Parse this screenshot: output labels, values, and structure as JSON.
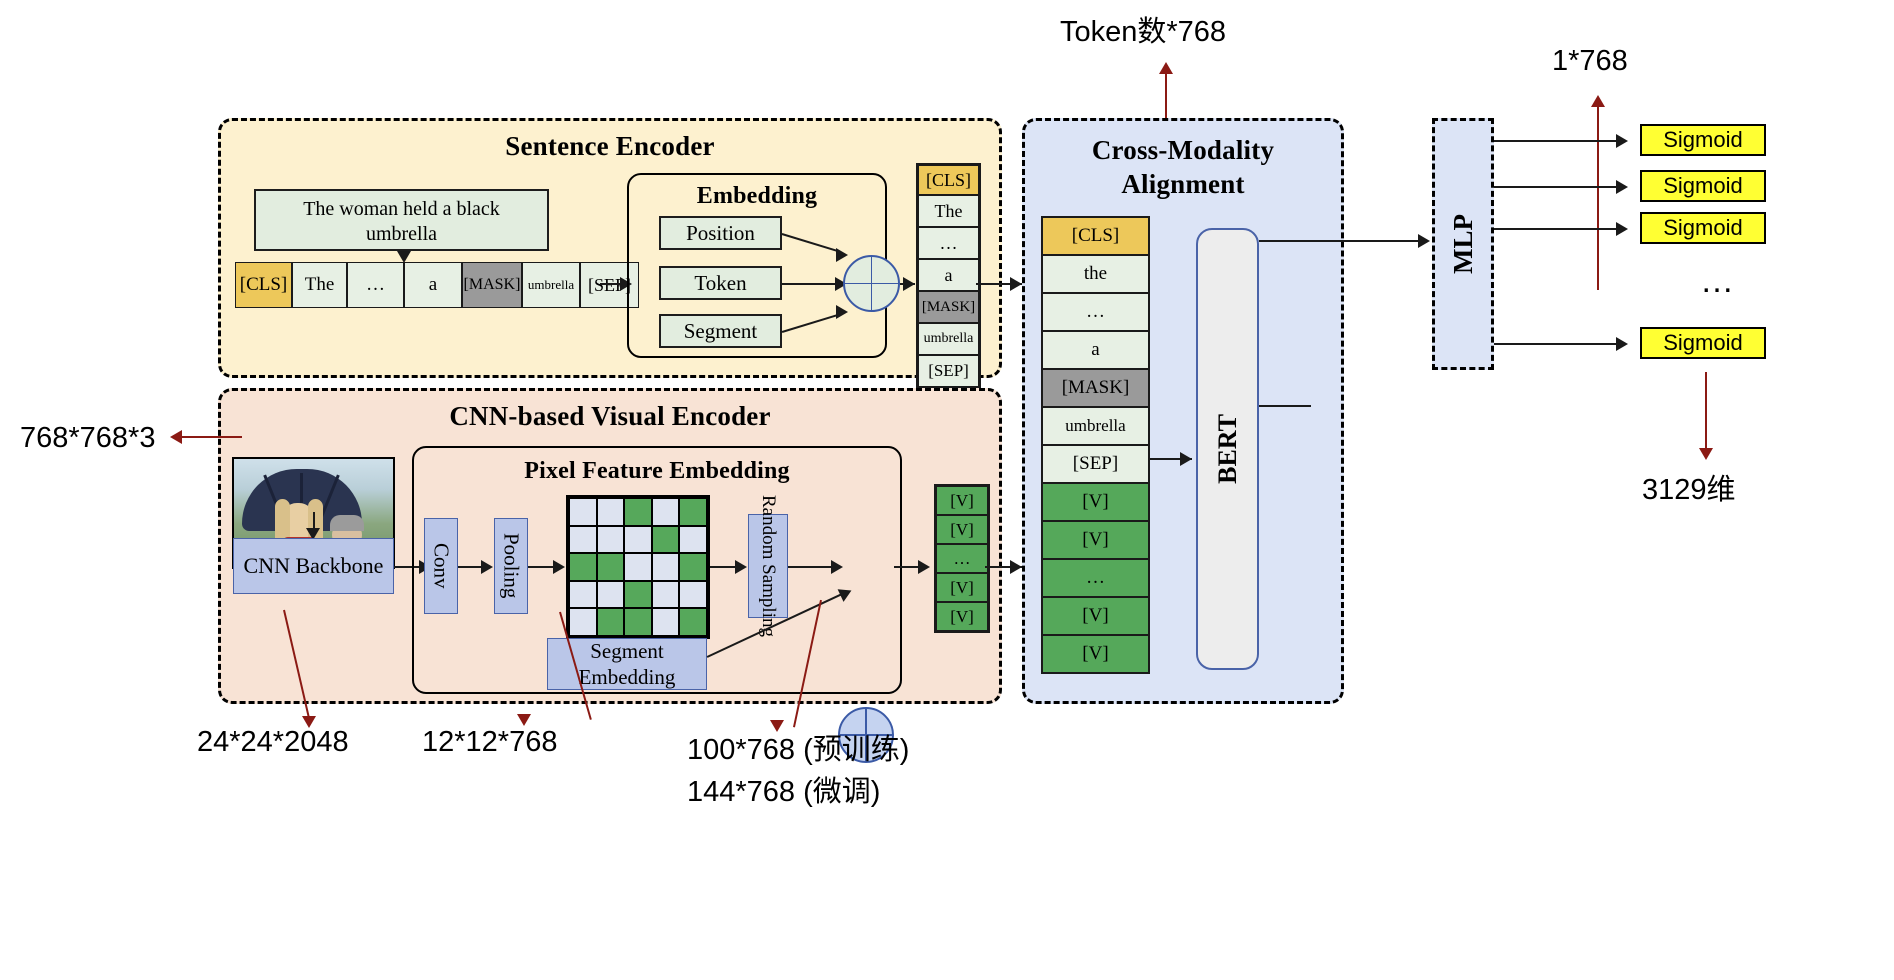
{
  "panels": {
    "sentence_encoder": {
      "title": "Sentence Encoder"
    },
    "visual_encoder": {
      "title": "CNN-based Visual Encoder"
    },
    "cross_modality": {
      "title_line1": "Cross-Modality",
      "title_line2": "Alignment"
    }
  },
  "sentence": {
    "caption": "The woman held a black umbrella",
    "input_tokens": [
      {
        "text": "[CLS]",
        "type": "cls"
      },
      {
        "text": "The",
        "type": "pale"
      },
      {
        "text": "…",
        "type": "pale"
      },
      {
        "text": "a",
        "type": "pale"
      },
      {
        "text": "[MASK]",
        "type": "mask"
      },
      {
        "text": "umbrella",
        "type": "pale"
      },
      {
        "text": "[SEP]",
        "type": "pale"
      }
    ],
    "embedding": {
      "title": "Embedding",
      "items": [
        "Position",
        "Token",
        "Segment"
      ]
    },
    "output_tokens": [
      {
        "text": "[CLS]",
        "type": "cls"
      },
      {
        "text": "The",
        "type": "pale"
      },
      {
        "text": "…",
        "type": "pale"
      },
      {
        "text": "a",
        "type": "pale"
      },
      {
        "text": "[MASK]",
        "type": "mask"
      },
      {
        "text": "umbrella",
        "type": "pale"
      },
      {
        "text": "[SEP]",
        "type": "pale"
      }
    ]
  },
  "visual": {
    "cnn_backbone": "CNN Backbone",
    "conv": "Conv",
    "pooling": "Pooling",
    "random_sampling": "Random Sampling",
    "pixel_feature_embedding_title": "Pixel Feature Embedding",
    "segment_embedding": "Segment Embedding",
    "grid": [
      [
        0,
        0,
        1,
        0,
        1
      ],
      [
        0,
        0,
        0,
        1,
        0
      ],
      [
        1,
        1,
        0,
        0,
        1
      ],
      [
        0,
        0,
        1,
        0,
        0
      ],
      [
        0,
        1,
        1,
        0,
        1
      ]
    ],
    "visual_tokens": [
      {
        "text": "[V]",
        "type": "v"
      },
      {
        "text": "[V]",
        "type": "v"
      },
      {
        "text": "…",
        "type": "v"
      },
      {
        "text": "[V]",
        "type": "v"
      },
      {
        "text": "[V]",
        "type": "v"
      }
    ]
  },
  "cross": {
    "tokens": [
      {
        "text": "[CLS]",
        "type": "cls"
      },
      {
        "text": "the",
        "type": "pale"
      },
      {
        "text": "…",
        "type": "pale"
      },
      {
        "text": "a",
        "type": "pale"
      },
      {
        "text": "[MASK]",
        "type": "mask"
      },
      {
        "text": "umbrella",
        "type": "pale"
      },
      {
        "text": "[SEP]",
        "type": "pale"
      },
      {
        "text": "[V]",
        "type": "v"
      },
      {
        "text": "[V]",
        "type": "v"
      },
      {
        "text": "…",
        "type": "v"
      },
      {
        "text": "[V]",
        "type": "v"
      },
      {
        "text": "[V]",
        "type": "v"
      }
    ],
    "bert": "BERT"
  },
  "head": {
    "mlp": "MLP",
    "sigmoids": [
      "Sigmoid",
      "Sigmoid",
      "Sigmoid",
      "Sigmoid"
    ],
    "ellipsis": "…"
  },
  "annotations": {
    "token_dim": "Token数*768",
    "cls_dim": "1*768",
    "image_dim": "768*768*3",
    "backbone_dim": "24*24*2048",
    "pooled_dim": "12*12*768",
    "sampled_pre": "100*768 (预训练)",
    "sampled_fine": "144*768 (微调)",
    "output_dim": "3129维"
  },
  "colors": {
    "sentence_panel": "#fdf1cf",
    "visual_panel": "#f8e3d5",
    "cross_panel": "#dce4f6",
    "cls": "#edc85a",
    "mask": "#9a9a9a",
    "visual_token": "#55a85a",
    "sigmoid": "#ffff33",
    "red_arrow": "#8b1a14",
    "blue_box": "#bac6e8"
  }
}
